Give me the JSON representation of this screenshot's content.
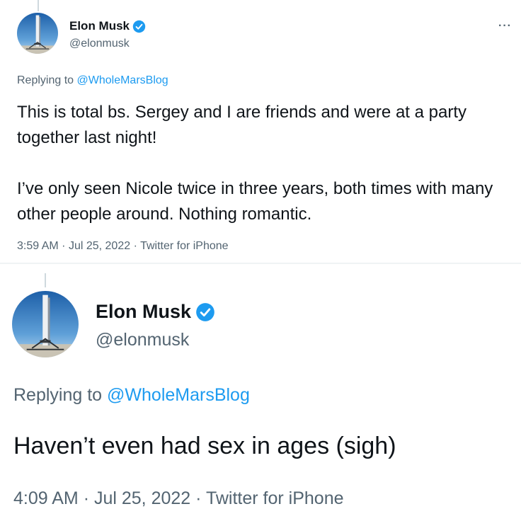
{
  "colors": {
    "text": "#0f1419",
    "secondary": "#536471",
    "link": "#1d9bf0",
    "verified": "#1d9bf0"
  },
  "tweets": [
    {
      "author": {
        "name": "Elon Musk",
        "handle": "@elonmusk",
        "verified": true
      },
      "menu_icon": "more-icon",
      "more_label": "···",
      "reply_prefix": "Replying to",
      "reply_to": "@WholeMarsBlog",
      "text_lines": [
        "This is total bs. Sergey and I are friends and were at a party together last night!",
        "I’ve only seen Nicole twice in three years, both times with many other people around. Nothing romantic."
      ],
      "time": "3:59 AM",
      "date": "Jul 25, 2022",
      "source": "Twitter for iPhone"
    },
    {
      "author": {
        "name": "Elon Musk",
        "handle": "@elonmusk",
        "verified": true
      },
      "reply_prefix": "Replying to",
      "reply_to": "@WholeMarsBlog",
      "text_lines": [
        "Haven’t even had sex in ages (sigh)"
      ],
      "time": "4:09 AM",
      "date": "Jul 25, 2022",
      "source": "Twitter for iPhone"
    }
  ]
}
